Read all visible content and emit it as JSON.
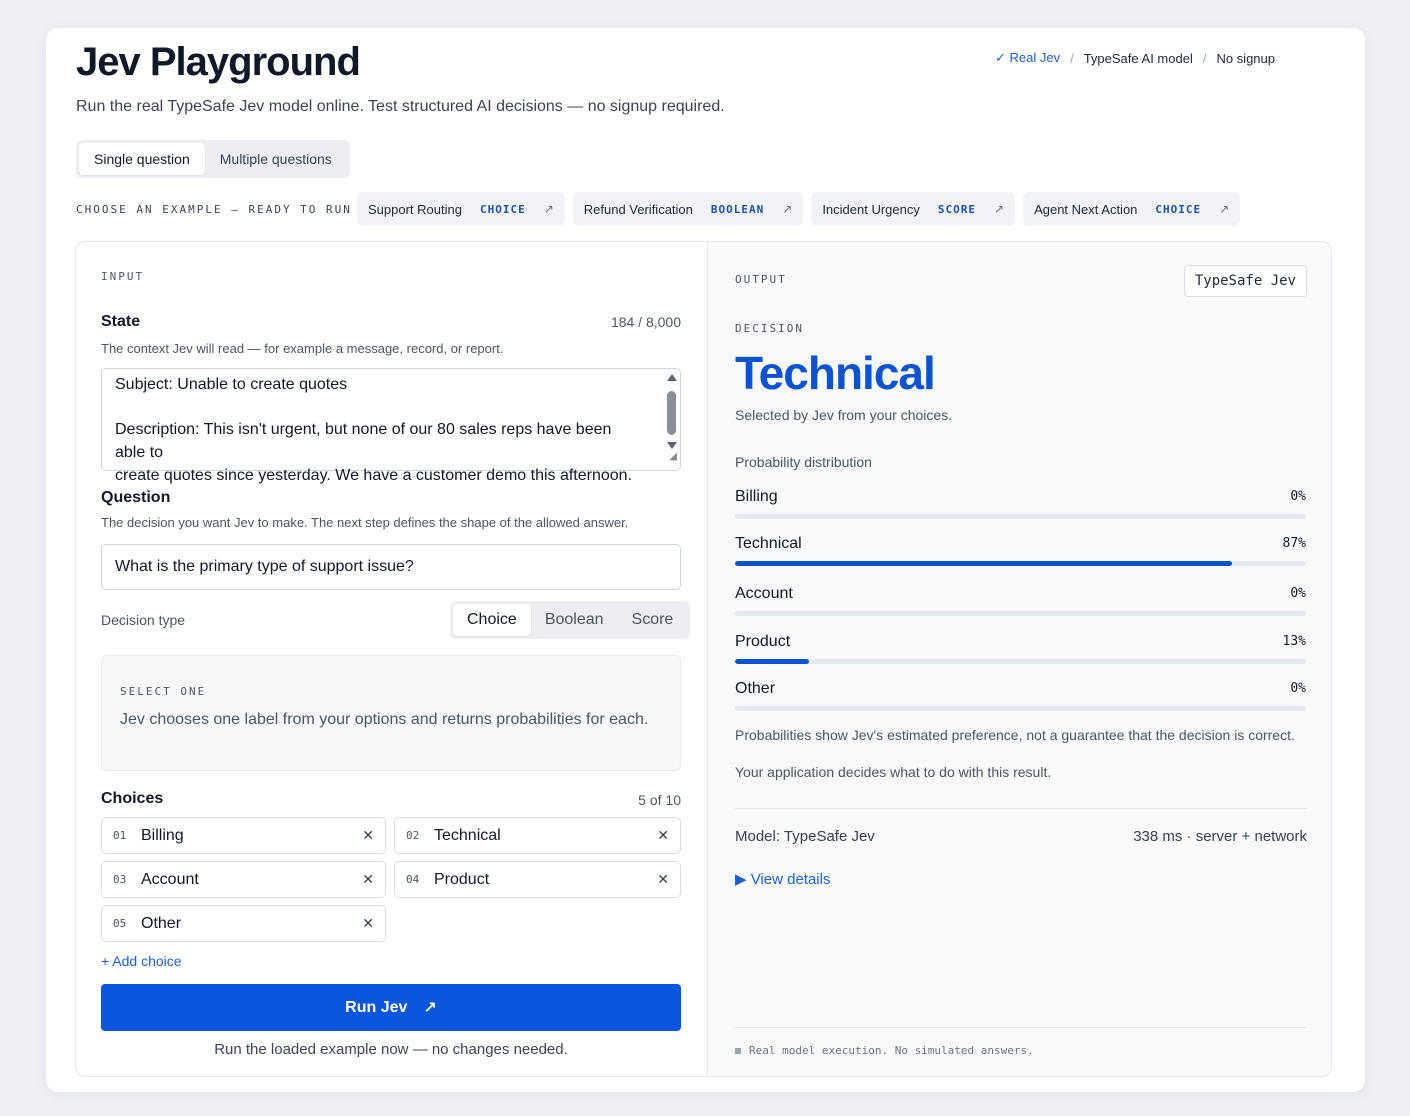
{
  "header": {
    "title": "Jev Playground",
    "subtitle": "Run the real TypeSafe Jev model online. Test structured AI decisions — no signup required.",
    "breadcrumb": [
      "✓ Real Jev",
      "TypeSafe AI model",
      "No signup"
    ]
  },
  "mode_tabs": [
    "Single question",
    "Multiple questions"
  ],
  "examples": {
    "label": "CHOOSE AN EXAMPLE — READY TO RUN",
    "items": [
      {
        "name": "Support Routing",
        "tag": "CHOICE"
      },
      {
        "name": "Refund Verification",
        "tag": "BOOLEAN"
      },
      {
        "name": "Incident Urgency",
        "tag": "SCORE"
      },
      {
        "name": "Agent Next Action",
        "tag": "CHOICE"
      }
    ],
    "arrow": "↗"
  },
  "input": {
    "section_label": "INPUT",
    "state": {
      "title": "State",
      "counter": "184 / 8,000",
      "help": "The context Jev will read — for example a message, record, or report.",
      "lines": [
        "Subject: Unable to create quotes",
        "",
        "Description: This isn't urgent, but none of our 80 sales reps have been able to",
        "create quotes since yesterday. We have a customer demo this afternoon."
      ]
    },
    "question": {
      "title": "Question",
      "help": "The decision you want Jev to make. The next step defines the shape of the allowed answer.",
      "value": "What is the primary type of support issue?"
    },
    "decision_type": {
      "label": "Decision type",
      "options": [
        "Choice",
        "Boolean",
        "Score"
      ],
      "selected": "Choice"
    },
    "select_card": {
      "label": "SELECT ONE",
      "description": "Jev chooses one label from your options and returns probabilities for each."
    },
    "choices": {
      "title": "Choices",
      "counter": "5 of 10",
      "items": [
        {
          "num": "01",
          "label": "Billing"
        },
        {
          "num": "02",
          "label": "Technical"
        },
        {
          "num": "03",
          "label": "Account"
        },
        {
          "num": "04",
          "label": "Product"
        },
        {
          "num": "05",
          "label": "Other"
        }
      ],
      "remove_glyph": "✕",
      "add_label": "+ Add choice"
    },
    "run": {
      "label": "Run Jev",
      "arrow": "↗",
      "note": "Run the loaded example now — no changes needed."
    }
  },
  "output": {
    "section_label": "OUTPUT",
    "model_badge": "TypeSafe Jev",
    "decision_label": "DECISION",
    "decision_value": "Technical",
    "decision_note": "Selected by Jev from your choices.",
    "distribution_title": "Probability distribution",
    "distribution": [
      {
        "label": "Billing",
        "pct_text": "0%",
        "value": 0
      },
      {
        "label": "Technical",
        "pct_text": "87%",
        "value": 0.87
      },
      {
        "label": "Account",
        "pct_text": "0%",
        "value": 0
      },
      {
        "label": "Product",
        "pct_text": "13%",
        "value": 0.13
      },
      {
        "label": "Other",
        "pct_text": "0%",
        "value": 0
      }
    ],
    "note1": "Probabilities show Jev's estimated preference, not a guarantee that the decision is correct.",
    "note2": "Your application decides what to do with this result.",
    "model_name": "Model: TypeSafe Jev",
    "latency": "338 ms · server + network",
    "view_details": "▶ View details",
    "footer": "Real model execution. No simulated answers."
  },
  "colors": {
    "accent": "#0b52d4",
    "button": "#0a56dd"
  }
}
